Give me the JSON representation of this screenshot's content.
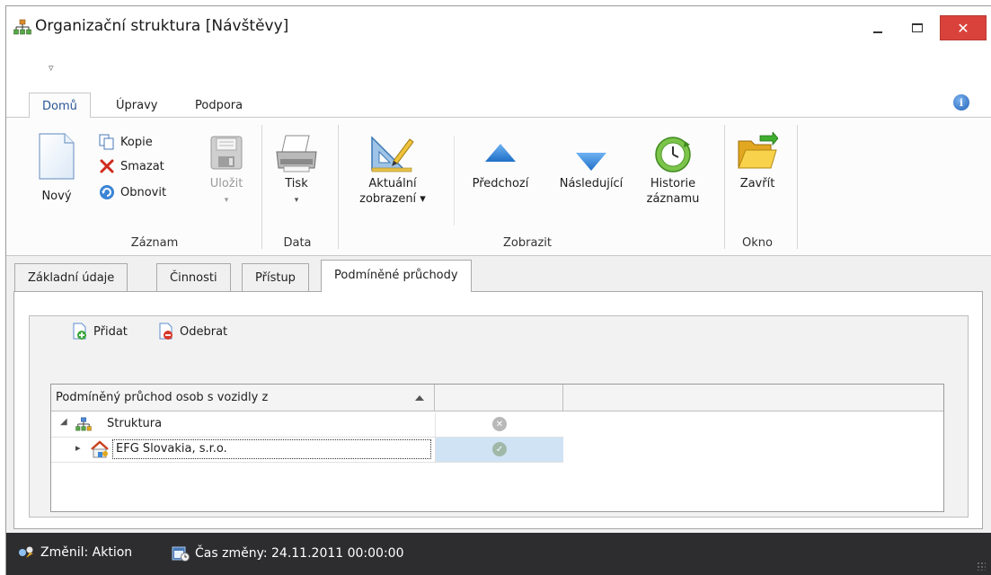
{
  "window": {
    "title": "Organizační struktura [Návštěvy]",
    "close_glyph": "✕"
  },
  "quick_access": {
    "glyph": "▿"
  },
  "ribbon": {
    "tabs": [
      {
        "label": "Domů",
        "active": true
      },
      {
        "label": "Úpravy",
        "active": false
      },
      {
        "label": "Podpora",
        "active": false
      }
    ],
    "info_glyph": "i",
    "groups": {
      "zaznam": {
        "label": "Záznam",
        "novy": "Nový",
        "kopie": "Kopie",
        "smazat": "Smazat",
        "obnovit": "Obnovit",
        "ulozit": "Uložit"
      },
      "data": {
        "label": "Data",
        "tisk": "Tisk"
      },
      "zobrazit": {
        "label": "Zobrazit",
        "aktualni_line1": "Aktuální",
        "aktualni_line2": "zobrazení ▾",
        "predchozi": "Předchozí",
        "nasledujici": "Následující",
        "historie_line1": "Historie",
        "historie_line2": "záznamu"
      },
      "okno": {
        "label": "Okno",
        "zavrit": "Zavřít"
      }
    },
    "dropdown_glyph": "▾"
  },
  "content_tabs": [
    {
      "label": "Základní údaje",
      "active": false
    },
    {
      "label": "Činnosti",
      "active": false
    },
    {
      "label": "Přístup",
      "active": false
    },
    {
      "label": "Podmíněné průchody",
      "active": true
    }
  ],
  "toolbar": {
    "pridat": "Přidat",
    "odebrat": "Odebrat"
  },
  "grid": {
    "header": "Podmíněný průchod osob s vozidly z",
    "rows": [
      {
        "label": "Struktura",
        "expand": "◢",
        "status": "denied",
        "status_glyph": "✕"
      },
      {
        "label": "EFG Slovakia, s.r.o.",
        "expand": "▸",
        "status": "allowed",
        "status_glyph": "✓"
      }
    ]
  },
  "statusbar": {
    "changed_by": "Změnil: Aktion",
    "changed_time": "Čas změny: 24.11.2011 00:00:00"
  },
  "colors": {
    "accent_blue": "#2b5797",
    "close_red": "#d9423b",
    "statusbar_bg": "#2d2d30",
    "selection": "#cfe3f4"
  }
}
